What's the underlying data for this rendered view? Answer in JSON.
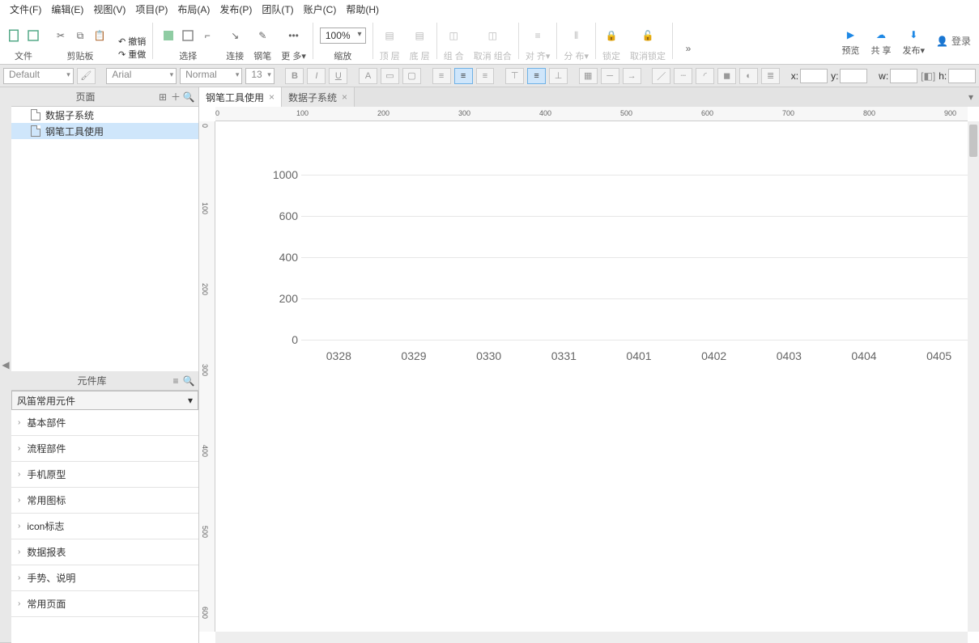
{
  "menu": [
    "文件(F)",
    "编辑(E)",
    "视图(V)",
    "项目(P)",
    "布局(A)",
    "发布(P)",
    "团队(T)",
    "账户(C)",
    "帮助(H)"
  ],
  "toolbar": {
    "file": "文件",
    "clipboard": "剪贴板",
    "undo": "撤销",
    "redo": "重做",
    "select": "选择",
    "connect": "连接",
    "pen": "钢笔",
    "more": "更 多▾",
    "zoom_val": "100%",
    "zoom_lbl": "缩放",
    "front": "顶 层",
    "back": "底 层",
    "group": "组 合",
    "ungroup": "取消 组合",
    "align": "对 齐▾",
    "distribute": "分 布▾",
    "lock": "锁定",
    "unlock": "取消锁定",
    "preview": "预览",
    "share": "共 享",
    "publish": "发布▾",
    "login": "登录"
  },
  "fmt": {
    "style": "Default",
    "font": "Arial",
    "weight": "Normal",
    "size": "13"
  },
  "coords": {
    "x": "x:",
    "y": "y:",
    "w": "w:",
    "h": "h:",
    "toggle": "[◧]"
  },
  "pages": {
    "title": "页面",
    "items": [
      {
        "label": "数据子系统",
        "sel": false
      },
      {
        "label": "钢笔工具使用",
        "sel": true
      }
    ]
  },
  "library": {
    "title": "元件库",
    "dropdown": "风笛常用元件",
    "cats": [
      "基本部件",
      "流程部件",
      "手机原型",
      "常用图标",
      "icon标志",
      "数据报表",
      "手势、说明",
      "常用页面"
    ]
  },
  "tabs": [
    {
      "label": "钢笔工具使用",
      "active": true
    },
    {
      "label": "数据子系统",
      "active": false
    }
  ],
  "hruler": [
    "0",
    "100",
    "200",
    "300",
    "400",
    "500",
    "600",
    "700",
    "800",
    "900"
  ],
  "vruler": [
    "0",
    "100",
    "200",
    "300",
    "400",
    "500",
    "600"
  ],
  "chart_data": {
    "type": "line",
    "categories": [
      "0328",
      "0329",
      "0330",
      "0331",
      "0401",
      "0402",
      "0403",
      "0404",
      "0405"
    ],
    "series": [],
    "yticks": [
      0,
      200,
      400,
      600,
      1000
    ],
    "ylim": [
      0,
      1000
    ],
    "title": "",
    "xlabel": "",
    "ylabel": ""
  }
}
